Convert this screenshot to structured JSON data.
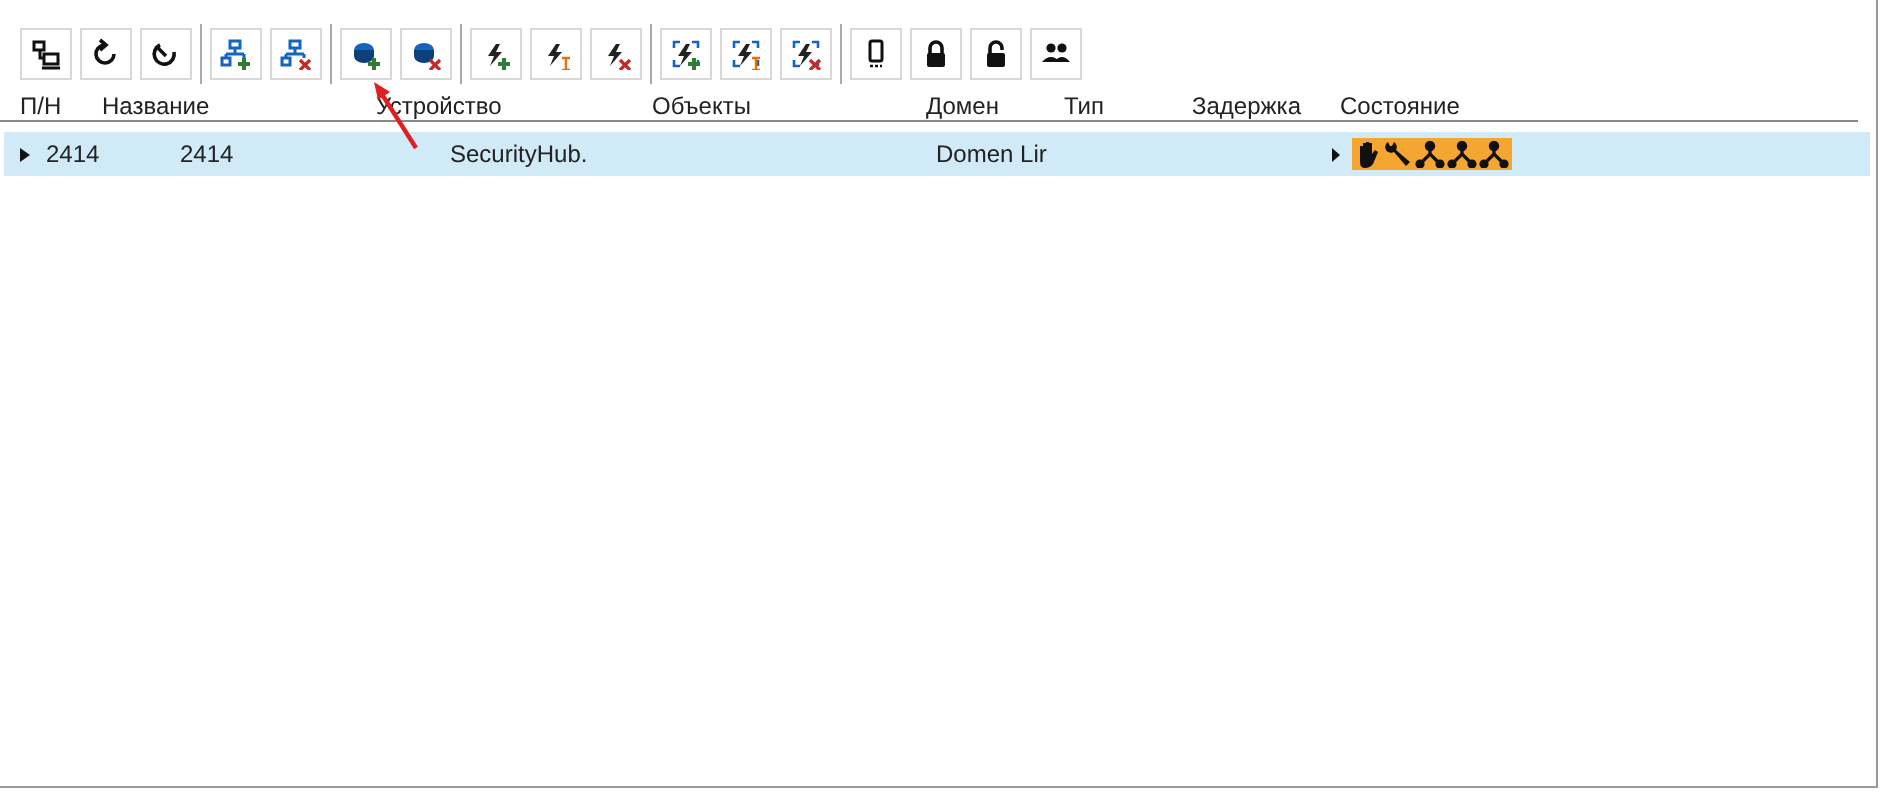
{
  "table": {
    "columns": [
      "П/Н",
      "Название",
      "Устройство",
      "Объекты",
      "Домен",
      "Тип",
      "Задержка",
      "Состояние"
    ],
    "rows": [
      {
        "selected": true,
        "expanded": false,
        "pn": "2414",
        "name": "2414",
        "device": "SecurityHub.",
        "domain": "Domen Lir"
      }
    ]
  }
}
